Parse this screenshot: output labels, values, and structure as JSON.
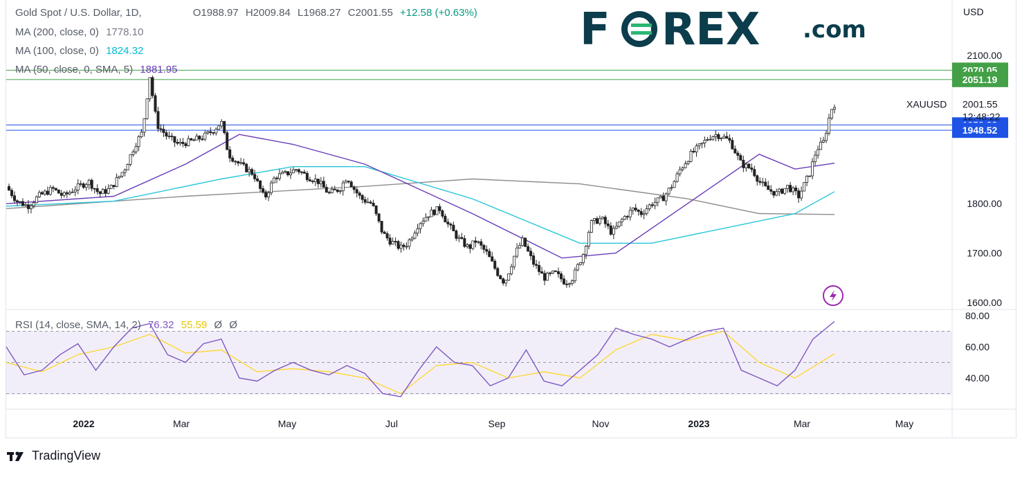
{
  "header": {
    "symbol_title": "Gold Spot / U.S. Dollar, 1D,",
    "ohlc": {
      "open": "O1988.97",
      "high": "H2009.84",
      "low": "L1968.27",
      "close": "C2001.55",
      "change": "+12.58 (+0.63%)"
    },
    "currency": "USD"
  },
  "indicators": {
    "ma200": {
      "label": "MA (200, close, 0)",
      "value": "1778.10",
      "color": "#8c8c8c"
    },
    "ma100": {
      "label": "MA (100, close, 0)",
      "value": "1824.32",
      "color": "#26c6da"
    },
    "ma50": {
      "label": "MA (50, close, 0, SMA, 5)",
      "value": "1881.95",
      "color": "#673ab7"
    },
    "rsi": {
      "label": "RSI (14, close, SMA, 14, 2)",
      "value": "76.32",
      "sma_value": "55.59",
      "extra1": "Ø",
      "extra2": "Ø",
      "color": "#7e57c2",
      "sma_color": "#fdd835"
    }
  },
  "logo": {
    "text_left": "F",
    "text_right": "REX",
    "suffix": ".com",
    "color": "#0b3d4c",
    "accent": "#2bb673"
  },
  "footer": {
    "brand": "TradingView"
  },
  "price_tag": {
    "symbol": "XAUUSD",
    "price": "2001.55",
    "countdown": "12:48:22"
  },
  "levels": [
    {
      "value": 2070.05,
      "label": "2070.05",
      "color": "#43a047"
    },
    {
      "value": 2051.19,
      "label": "2051.19",
      "color": "#43a047"
    },
    {
      "value": 1959.33,
      "label": "1959.33",
      "color": "#1e53e5"
    },
    {
      "value": 1948.52,
      "label": "1948.52",
      "color": "#1e53e5"
    }
  ],
  "chart_data": {
    "type": "candlestick",
    "title": "Gold Spot / U.S. Dollar, 1D",
    "x_ticks": [
      "2022",
      "Mar",
      "May",
      "Jul",
      "Sep",
      "Nov",
      "2023",
      "Mar",
      "May"
    ],
    "y_ticks": [
      "2100.00",
      "1800.00",
      "1700.00",
      "1600.00"
    ],
    "ylim": [
      1600,
      2100
    ],
    "rsi_ticks": [
      "80.00",
      "60.00",
      "40.00"
    ],
    "rsi_range": [
      20,
      85
    ],
    "rsi_bands": [
      70,
      50,
      30
    ],
    "price_path": [
      [
        0,
        1835
      ],
      [
        0.03,
        1805
      ],
      [
        0.06,
        1795
      ],
      [
        0.09,
        1815
      ],
      [
        0.13,
        1830
      ],
      [
        0.16,
        1815
      ],
      [
        0.19,
        1830
      ],
      [
        0.23,
        1845
      ],
      [
        0.26,
        1820
      ],
      [
        0.29,
        1830
      ],
      [
        0.33,
        1870
      ],
      [
        0.36,
        1920
      ],
      [
        0.38,
        1945
      ],
      [
        0.4,
        2060
      ],
      [
        0.42,
        1960
      ],
      [
        0.45,
        1935
      ],
      [
        0.48,
        1920
      ],
      [
        0.51,
        1925
      ],
      [
        0.55,
        1935
      ],
      [
        0.58,
        1950
      ],
      [
        0.6,
        1965
      ],
      [
        0.62,
        1900
      ],
      [
        0.65,
        1880
      ],
      [
        0.67,
        1870
      ],
      [
        0.69,
        1860
      ],
      [
        0.72,
        1810
      ],
      [
        0.75,
        1855
      ],
      [
        0.78,
        1860
      ],
      [
        0.81,
        1870
      ],
      [
        0.84,
        1855
      ],
      [
        0.87,
        1845
      ],
      [
        0.9,
        1820
      ],
      [
        0.93,
        1830
      ],
      [
        0.95,
        1855
      ],
      [
        0.97,
        1830
      ],
      [
        0.99,
        1810
      ],
      [
        1.02,
        1800
      ],
      [
        1.05,
        1740
      ],
      [
        1.07,
        1725
      ],
      [
        1.1,
        1710
      ],
      [
        1.12,
        1720
      ],
      [
        1.15,
        1760
      ],
      [
        1.18,
        1780
      ],
      [
        1.21,
        1790
      ],
      [
        1.23,
        1760
      ],
      [
        1.26,
        1730
      ],
      [
        1.29,
        1710
      ],
      [
        1.31,
        1725
      ],
      [
        1.34,
        1700
      ],
      [
        1.37,
        1660
      ],
      [
        1.39,
        1640
      ],
      [
        1.42,
        1700
      ],
      [
        1.44,
        1725
      ],
      [
        1.47,
        1680
      ],
      [
        1.5,
        1650
      ],
      [
        1.53,
        1660
      ],
      [
        1.56,
        1640
      ],
      [
        1.58,
        1650
      ],
      [
        1.61,
        1700
      ],
      [
        1.63,
        1760
      ],
      [
        1.66,
        1770
      ],
      [
        1.69,
        1740
      ],
      [
        1.72,
        1770
      ],
      [
        1.75,
        1790
      ],
      [
        1.77,
        1780
      ],
      [
        1.8,
        1800
      ],
      [
        1.83,
        1810
      ],
      [
        1.86,
        1840
      ],
      [
        1.88,
        1870
      ],
      [
        1.91,
        1900
      ],
      [
        1.94,
        1920
      ],
      [
        1.96,
        1935
      ],
      [
        1.98,
        1940
      ],
      [
        2.0,
        1935
      ],
      [
        2.02,
        1925
      ],
      [
        2.05,
        1880
      ],
      [
        2.08,
        1870
      ],
      [
        2.1,
        1845
      ],
      [
        2.12,
        1830
      ],
      [
        2.15,
        1820
      ],
      [
        2.18,
        1835
      ],
      [
        2.21,
        1815
      ],
      [
        2.24,
        1860
      ],
      [
        2.26,
        1910
      ],
      [
        2.28,
        1925
      ],
      [
        2.3,
        1990
      ],
      [
        2.31,
        2001.55
      ]
    ],
    "ma_series": [
      {
        "name": "MA 200",
        "values": [
          [
            0,
            1790
          ],
          [
            0.5,
            1815
          ],
          [
            1.0,
            1835
          ],
          [
            1.3,
            1850
          ],
          [
            1.6,
            1840
          ],
          [
            1.9,
            1810
          ],
          [
            2.1,
            1780
          ],
          [
            2.31,
            1778.1
          ]
        ]
      },
      {
        "name": "MA 100",
        "values": [
          [
            0,
            1795
          ],
          [
            0.3,
            1805
          ],
          [
            0.6,
            1850
          ],
          [
            0.8,
            1875
          ],
          [
            1.0,
            1875
          ],
          [
            1.3,
            1810
          ],
          [
            1.6,
            1720
          ],
          [
            1.8,
            1720
          ],
          [
            2.0,
            1750
          ],
          [
            2.2,
            1780
          ],
          [
            2.31,
            1824.32
          ]
        ]
      },
      {
        "name": "MA 50",
        "values": [
          [
            0,
            1800
          ],
          [
            0.3,
            1815
          ],
          [
            0.5,
            1880
          ],
          [
            0.65,
            1940
          ],
          [
            0.8,
            1920
          ],
          [
            1.0,
            1880
          ],
          [
            1.3,
            1780
          ],
          [
            1.55,
            1690
          ],
          [
            1.7,
            1700
          ],
          [
            1.9,
            1800
          ],
          [
            2.1,
            1900
          ],
          [
            2.2,
            1870
          ],
          [
            2.31,
            1881.95
          ]
        ]
      }
    ],
    "rsi_series": [
      [
        0,
        60
      ],
      [
        0.05,
        42
      ],
      [
        0.1,
        45
      ],
      [
        0.15,
        55
      ],
      [
        0.2,
        62
      ],
      [
        0.25,
        45
      ],
      [
        0.3,
        60
      ],
      [
        0.35,
        72
      ],
      [
        0.4,
        75
      ],
      [
        0.45,
        55
      ],
      [
        0.5,
        50
      ],
      [
        0.55,
        62
      ],
      [
        0.6,
        65
      ],
      [
        0.65,
        40
      ],
      [
        0.7,
        38
      ],
      [
        0.75,
        45
      ],
      [
        0.8,
        50
      ],
      [
        0.85,
        45
      ],
      [
        0.9,
        42
      ],
      [
        0.95,
        48
      ],
      [
        1.0,
        43
      ],
      [
        1.05,
        30
      ],
      [
        1.1,
        28
      ],
      [
        1.15,
        45
      ],
      [
        1.2,
        60
      ],
      [
        1.25,
        50
      ],
      [
        1.3,
        48
      ],
      [
        1.35,
        35
      ],
      [
        1.4,
        40
      ],
      [
        1.45,
        58
      ],
      [
        1.5,
        38
      ],
      [
        1.55,
        35
      ],
      [
        1.6,
        45
      ],
      [
        1.65,
        55
      ],
      [
        1.7,
        72
      ],
      [
        1.75,
        68
      ],
      [
        1.8,
        65
      ],
      [
        1.85,
        60
      ],
      [
        1.9,
        65
      ],
      [
        1.95,
        70
      ],
      [
        2.0,
        72
      ],
      [
        2.05,
        45
      ],
      [
        2.1,
        40
      ],
      [
        2.15,
        35
      ],
      [
        2.2,
        45
      ],
      [
        2.25,
        65
      ],
      [
        2.31,
        76.32
      ]
    ],
    "rsi_sma_series": [
      [
        0,
        50
      ],
      [
        0.1,
        44
      ],
      [
        0.2,
        55
      ],
      [
        0.3,
        60
      ],
      [
        0.4,
        68
      ],
      [
        0.5,
        56
      ],
      [
        0.6,
        58
      ],
      [
        0.7,
        44
      ],
      [
        0.8,
        46
      ],
      [
        0.9,
        44
      ],
      [
        1.0,
        40
      ],
      [
        1.1,
        30
      ],
      [
        1.2,
        48
      ],
      [
        1.3,
        50
      ],
      [
        1.4,
        40
      ],
      [
        1.5,
        44
      ],
      [
        1.6,
        40
      ],
      [
        1.7,
        58
      ],
      [
        1.8,
        68
      ],
      [
        1.9,
        64
      ],
      [
        2.0,
        70
      ],
      [
        2.1,
        50
      ],
      [
        2.2,
        40
      ],
      [
        2.31,
        55.59
      ]
    ]
  }
}
